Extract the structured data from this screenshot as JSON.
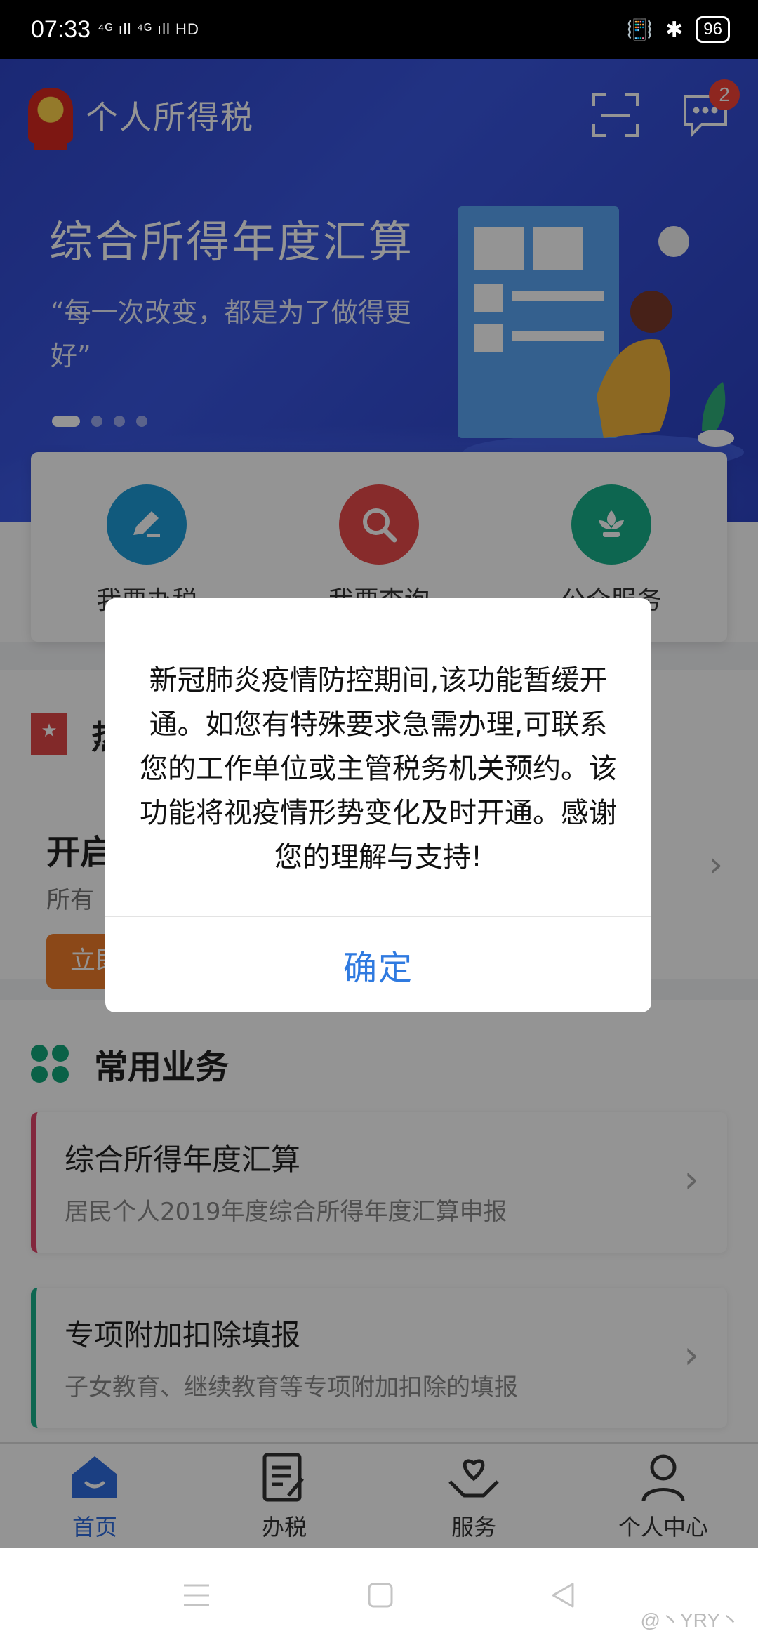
{
  "status_bar": {
    "time": "07:33",
    "signal_text": "⁴ᴳ ıll ⁴ᴳ ıll HD",
    "battery": "96"
  },
  "header": {
    "app_title": "个人所得税",
    "message_badge": "2"
  },
  "banner": {
    "title": "综合所得年度汇算",
    "quote": "“每一次改变，都是为了做得更好”"
  },
  "quick_actions": [
    {
      "label": "我要办税",
      "color": "#1e9bd8"
    },
    {
      "label": "我要查询",
      "color": "#e84a4a"
    },
    {
      "label": "公众服务",
      "color": "#17b08a"
    }
  ],
  "notice": {
    "heading": "热",
    "big_text": "开启",
    "small_text": "所有",
    "button": "立即"
  },
  "common": {
    "title": "常用业务",
    "items": [
      {
        "title": "综合所得年度汇算",
        "desc": "居民个人2019年度综合所得年度汇算申报",
        "accent": "#e0446a"
      },
      {
        "title": "专项附加扣除填报",
        "desc": "子女教育、继续教育等专项附加扣除的填报",
        "accent": "#17b08a"
      }
    ]
  },
  "tabs": [
    {
      "label": "首页"
    },
    {
      "label": "办税"
    },
    {
      "label": "服务"
    },
    {
      "label": "个人中心"
    }
  ],
  "dialog": {
    "message": "新冠肺炎疫情防控期间,该功能暂缓开通。如您有特殊要求急需办理,可联系您的工作单位或主管税务机关预约。该功能将视疫情形势变化及时开通。感谢您的理解与支持!",
    "confirm": "确定"
  },
  "watermark": "@丶YRY丶"
}
